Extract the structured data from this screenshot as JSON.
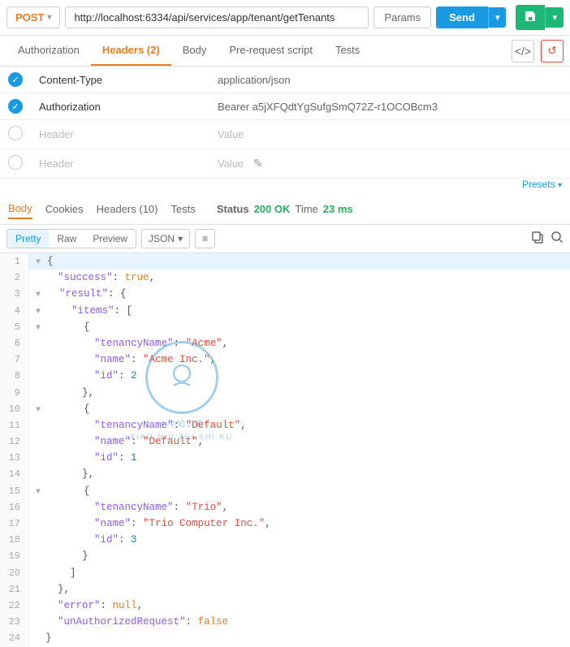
{
  "topbar": {
    "method": "POST",
    "method_arrow": "▾",
    "url": "http://localhost:6334/api/services/app/tenant/getTenants",
    "params_label": "Params",
    "send_label": "Send",
    "send_arrow": "▾",
    "save_arrow": "▾"
  },
  "request_tabs": [
    {
      "label": "Authorization",
      "active": false
    },
    {
      "label": "Headers (2)",
      "active": true
    },
    {
      "label": "Body",
      "active": false
    },
    {
      "label": "Pre-request script",
      "active": false
    },
    {
      "label": "Tests",
      "active": false
    }
  ],
  "tab_icons": [
    {
      "name": "code-icon",
      "symbol": "</>"
    },
    {
      "name": "refresh-icon",
      "symbol": "↺"
    }
  ],
  "headers": [
    {
      "checked": true,
      "key": "Content-Type",
      "value": "application/json",
      "editable": false
    },
    {
      "checked": true,
      "key": "Authorization",
      "value": "Bearer a5jXFQdtYgSufgSmQ72Z-r1OCOBcm3",
      "editable": false
    },
    {
      "checked": false,
      "key": "Header",
      "value": "Value",
      "editable": false
    },
    {
      "checked": false,
      "key": "Header",
      "value": "Value",
      "editable": true
    }
  ],
  "presets_label": "Presets",
  "presets_arrow": "▾",
  "response": {
    "tabs": [
      {
        "label": "Body",
        "active": true
      },
      {
        "label": "Cookies",
        "active": false
      },
      {
        "label": "Headers (10)",
        "active": false
      },
      {
        "label": "Tests",
        "active": false
      }
    ],
    "status_label": "Status",
    "status_code": "200 OK",
    "time_label": "Time",
    "time_value": "23 ms"
  },
  "json_toolbar": {
    "format_tabs": [
      {
        "label": "Pretty",
        "active": true
      },
      {
        "label": "Raw",
        "active": false
      },
      {
        "label": "Preview",
        "active": false
      }
    ],
    "type_btn": "JSON",
    "type_arrow": "▾",
    "wrap_btn": "≡"
  },
  "code_lines": [
    {
      "num": "1",
      "toggle": "▼",
      "content": "{",
      "tokens": [
        {
          "type": "p",
          "text": "{"
        }
      ]
    },
    {
      "num": "2",
      "toggle": "",
      "content": "  \"success\": true,",
      "tokens": [
        {
          "type": "p",
          "text": "  "
        },
        {
          "type": "k",
          "text": "\"success\""
        },
        {
          "type": "p",
          "text": ": "
        },
        {
          "type": "b",
          "text": "true"
        },
        {
          "type": "p",
          "text": ","
        }
      ]
    },
    {
      "num": "3",
      "toggle": "▼",
      "content": "  \"result\": {",
      "tokens": [
        {
          "type": "p",
          "text": "  "
        },
        {
          "type": "k",
          "text": "\"result\""
        },
        {
          "type": "p",
          "text": ": {"
        }
      ]
    },
    {
      "num": "4",
      "toggle": "▼",
      "content": "    \"items\": [",
      "tokens": [
        {
          "type": "p",
          "text": "    "
        },
        {
          "type": "k",
          "text": "\"items\""
        },
        {
          "type": "p",
          "text": ": ["
        }
      ]
    },
    {
      "num": "5",
      "toggle": "▼",
      "content": "      {",
      "tokens": [
        {
          "type": "p",
          "text": "      {"
        }
      ]
    },
    {
      "num": "6",
      "toggle": "",
      "content": "        \"tenancyName\": \"Acme\",",
      "tokens": [
        {
          "type": "p",
          "text": "        "
        },
        {
          "type": "k",
          "text": "\"tenancyName\""
        },
        {
          "type": "p",
          "text": ": "
        },
        {
          "type": "s",
          "text": "\"Acme\""
        },
        {
          "type": "p",
          "text": ","
        }
      ]
    },
    {
      "num": "7",
      "toggle": "",
      "content": "        \"name\": \"Acme Inc.\",",
      "tokens": [
        {
          "type": "p",
          "text": "        "
        },
        {
          "type": "k",
          "text": "\"name\""
        },
        {
          "type": "p",
          "text": ": "
        },
        {
          "type": "s",
          "text": "\"Acme Inc.\""
        },
        {
          "type": "p",
          "text": ","
        }
      ]
    },
    {
      "num": "8",
      "toggle": "",
      "content": "        \"id\": 2",
      "tokens": [
        {
          "type": "p",
          "text": "        "
        },
        {
          "type": "k",
          "text": "\"id\""
        },
        {
          "type": "p",
          "text": ": "
        },
        {
          "type": "n",
          "text": "2"
        }
      ]
    },
    {
      "num": "9",
      "toggle": "",
      "content": "      },",
      "tokens": [
        {
          "type": "p",
          "text": "      },"
        }
      ]
    },
    {
      "num": "10",
      "toggle": "▼",
      "content": "      {",
      "tokens": [
        {
          "type": "p",
          "text": "      {"
        }
      ]
    },
    {
      "num": "11",
      "toggle": "",
      "content": "        \"tenancyName\": \"Default\",",
      "tokens": [
        {
          "type": "p",
          "text": "        "
        },
        {
          "type": "k",
          "text": "\"tenancyName\""
        },
        {
          "type": "p",
          "text": ": "
        },
        {
          "type": "s",
          "text": "\"Default\""
        },
        {
          "type": "p",
          "text": ","
        }
      ]
    },
    {
      "num": "12",
      "toggle": "",
      "content": "        \"name\": \"Default\",",
      "tokens": [
        {
          "type": "p",
          "text": "        "
        },
        {
          "type": "k",
          "text": "\"name\""
        },
        {
          "type": "p",
          "text": ": "
        },
        {
          "type": "s",
          "text": "\"Default\""
        },
        {
          "type": "p",
          "text": ","
        }
      ]
    },
    {
      "num": "13",
      "toggle": "",
      "content": "        \"id\": 1",
      "tokens": [
        {
          "type": "p",
          "text": "        "
        },
        {
          "type": "k",
          "text": "\"id\""
        },
        {
          "type": "p",
          "text": ": "
        },
        {
          "type": "n",
          "text": "1"
        }
      ]
    },
    {
      "num": "14",
      "toggle": "",
      "content": "      },",
      "tokens": [
        {
          "type": "p",
          "text": "      },"
        }
      ]
    },
    {
      "num": "15",
      "toggle": "▼",
      "content": "      {",
      "tokens": [
        {
          "type": "p",
          "text": "      {"
        }
      ]
    },
    {
      "num": "16",
      "toggle": "",
      "content": "        \"tenancyName\": \"Trio\",",
      "tokens": [
        {
          "type": "p",
          "text": "        "
        },
        {
          "type": "k",
          "text": "\"tenancyName\""
        },
        {
          "type": "p",
          "text": ": "
        },
        {
          "type": "s",
          "text": "\"Trio\""
        },
        {
          "type": "p",
          "text": ","
        }
      ]
    },
    {
      "num": "17",
      "toggle": "",
      "content": "        \"name\": \"Trio Computer Inc.\",",
      "tokens": [
        {
          "type": "p",
          "text": "        "
        },
        {
          "type": "k",
          "text": "\"name\""
        },
        {
          "type": "p",
          "text": ": "
        },
        {
          "type": "s",
          "text": "\"Trio Computer Inc.\""
        },
        {
          "type": "p",
          "text": ","
        }
      ]
    },
    {
      "num": "18",
      "toggle": "",
      "content": "        \"id\": 3",
      "tokens": [
        {
          "type": "p",
          "text": "        "
        },
        {
          "type": "k",
          "text": "\"id\""
        },
        {
          "type": "p",
          "text": ": "
        },
        {
          "type": "n",
          "text": "3"
        }
      ]
    },
    {
      "num": "19",
      "toggle": "",
      "content": "      }",
      "tokens": [
        {
          "type": "p",
          "text": "      }"
        }
      ]
    },
    {
      "num": "20",
      "toggle": "",
      "content": "    ]",
      "tokens": [
        {
          "type": "p",
          "text": "    ]"
        }
      ]
    },
    {
      "num": "21",
      "toggle": "",
      "content": "  },",
      "tokens": [
        {
          "type": "p",
          "text": "  },"
        }
      ]
    },
    {
      "num": "22",
      "toggle": "",
      "content": "  \"error\": null,",
      "tokens": [
        {
          "type": "p",
          "text": "  "
        },
        {
          "type": "k",
          "text": "\"error\""
        },
        {
          "type": "p",
          "text": ": "
        },
        {
          "type": "b",
          "text": "null"
        },
        {
          "type": "p",
          "text": ","
        }
      ]
    },
    {
      "num": "23",
      "toggle": "",
      "content": "  \"unAuthorizedRequest\": false",
      "tokens": [
        {
          "type": "p",
          "text": "  "
        },
        {
          "type": "k",
          "text": "\"unAuthorizedRequest\""
        },
        {
          "type": "p",
          "text": ": "
        },
        {
          "type": "b",
          "text": "false"
        }
      ]
    },
    {
      "num": "24",
      "toggle": "",
      "content": "}",
      "tokens": [
        {
          "type": "p",
          "text": "}"
        }
      ]
    }
  ]
}
